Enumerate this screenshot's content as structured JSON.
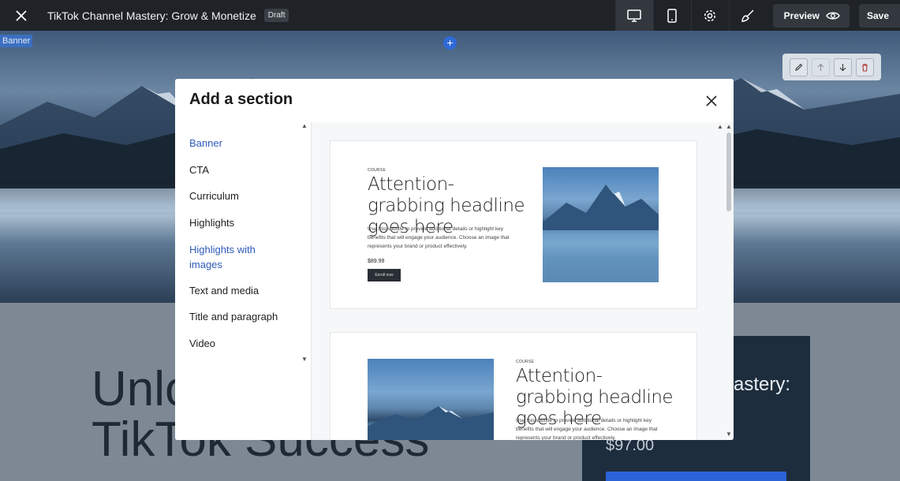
{
  "topbar": {
    "title": "TikTok Channel Mastery: Grow & Monetize",
    "badge": "Draft",
    "preview_label": "Preview",
    "save_label": "Save"
  },
  "banner": {
    "label": "Banner"
  },
  "page": {
    "hero_line1": "Unlo",
    "hero_line2": "TikTok Success",
    "card_title": "astery:",
    "card_price": "$97.00"
  },
  "modal": {
    "title": "Add a section",
    "categories": [
      {
        "label": "Banner",
        "active": true
      },
      {
        "label": "CTA",
        "active": false
      },
      {
        "label": "Curriculum",
        "active": false
      },
      {
        "label": "Highlights",
        "active": false
      },
      {
        "label": "Highlights with images",
        "active": true
      },
      {
        "label": "Text and media",
        "active": false
      },
      {
        "label": "Title and paragraph",
        "active": false
      },
      {
        "label": "Video",
        "active": false
      }
    ],
    "templates": [
      {
        "kicker": "COURSE",
        "headline": "Attention-grabbing headline goes here",
        "subtitle": "Use this subtitle to provide additional details or highlight key benefits that will engage your audience. Choose an image that represents your brand or product effectively.",
        "price": "$89.99",
        "button": "Enroll now"
      },
      {
        "kicker": "COURSE",
        "headline": "Attention-grabbing headline goes here",
        "subtitle": "Use this subtitle to provide additional details or highlight key benefits that will engage your audience. Choose an image that represents your brand or product effectively."
      }
    ]
  },
  "colors": {
    "topbar_bg": "#1f2328",
    "accent_blue": "#2e5bb8",
    "banner_label_bg": "#3c6fc0",
    "card_bg": "#1e2d3d"
  },
  "icons": [
    "close-icon",
    "desktop-icon",
    "mobile-icon",
    "gear-icon",
    "brush-icon",
    "eye-icon",
    "pencil-icon",
    "arrow-up-icon",
    "arrow-down-icon",
    "trash-icon",
    "plus-icon"
  ]
}
